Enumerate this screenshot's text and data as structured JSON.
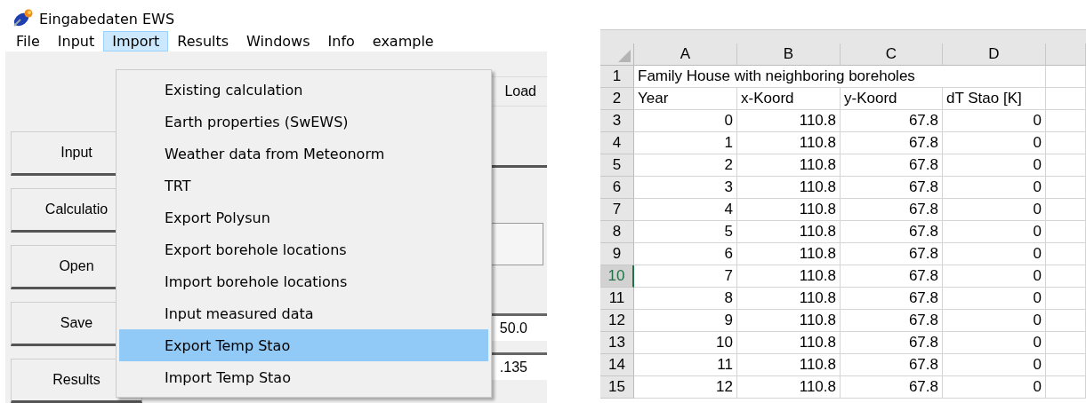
{
  "app": {
    "title": "Eingabedaten EWS",
    "menu": [
      {
        "label": "File",
        "selected": false
      },
      {
        "label": "Input",
        "selected": false
      },
      {
        "label": "Import",
        "selected": true
      },
      {
        "label": "Results",
        "selected": false
      },
      {
        "label": "Windows",
        "selected": false
      },
      {
        "label": "Info",
        "selected": false
      },
      {
        "label": "example",
        "selected": false
      }
    ],
    "side_buttons": [
      "Input",
      "Calculatio",
      "Open",
      "Save",
      "Results"
    ],
    "panel": {
      "load_label": "Load",
      "field_1": "50.0",
      "field_2": ".135"
    },
    "dropdown": [
      {
        "label": "Existing calculation",
        "selected": false
      },
      {
        "label": "Earth properties (SwEWS)",
        "selected": false
      },
      {
        "label": "Weather data from Meteonorm",
        "selected": false
      },
      {
        "label": "TRT",
        "selected": false
      },
      {
        "label": "Export Polysun",
        "selected": false
      },
      {
        "label": "Export borehole locations",
        "selected": false
      },
      {
        "label": "Import borehole locations",
        "selected": false
      },
      {
        "label": "Input measured data",
        "selected": false
      },
      {
        "label": "Export Temp Stao",
        "selected": true
      },
      {
        "label": "Import Temp Stao",
        "selected": false
      }
    ]
  },
  "sheet": {
    "columns": [
      "A",
      "B",
      "C",
      "D"
    ],
    "rows": [
      {
        "number": "1",
        "selected": false,
        "kind": "title",
        "cells": [
          "Family House with neighboring boreholes"
        ]
      },
      {
        "number": "2",
        "selected": false,
        "kind": "header",
        "cells": [
          "Year",
          "x-Koord",
          "y-Koord",
          "dT Stao [K]"
        ]
      },
      {
        "number": "3",
        "selected": false,
        "kind": "data",
        "cells": [
          "0",
          "110.8",
          "67.8",
          "0"
        ]
      },
      {
        "number": "4",
        "selected": false,
        "kind": "data",
        "cells": [
          "1",
          "110.8",
          "67.8",
          "0"
        ]
      },
      {
        "number": "5",
        "selected": false,
        "kind": "data",
        "cells": [
          "2",
          "110.8",
          "67.8",
          "0"
        ]
      },
      {
        "number": "6",
        "selected": false,
        "kind": "data",
        "cells": [
          "3",
          "110.8",
          "67.8",
          "0"
        ]
      },
      {
        "number": "7",
        "selected": false,
        "kind": "data",
        "cells": [
          "4",
          "110.8",
          "67.8",
          "0"
        ]
      },
      {
        "number": "8",
        "selected": false,
        "kind": "data",
        "cells": [
          "5",
          "110.8",
          "67.8",
          "0"
        ]
      },
      {
        "number": "9",
        "selected": false,
        "kind": "data",
        "cells": [
          "6",
          "110.8",
          "67.8",
          "0"
        ]
      },
      {
        "number": "10",
        "selected": true,
        "kind": "data",
        "cells": [
          "7",
          "110.8",
          "67.8",
          "0"
        ]
      },
      {
        "number": "11",
        "selected": false,
        "kind": "data",
        "cells": [
          "8",
          "110.8",
          "67.8",
          "0"
        ]
      },
      {
        "number": "12",
        "selected": false,
        "kind": "data",
        "cells": [
          "9",
          "110.8",
          "67.8",
          "0"
        ]
      },
      {
        "number": "13",
        "selected": false,
        "kind": "data",
        "cells": [
          "10",
          "110.8",
          "67.8",
          "0"
        ]
      },
      {
        "number": "14",
        "selected": false,
        "kind": "data",
        "cells": [
          "11",
          "110.8",
          "67.8",
          "0"
        ]
      },
      {
        "number": "15",
        "selected": false,
        "kind": "data",
        "cells": [
          "12",
          "110.8",
          "67.8",
          "0"
        ]
      }
    ]
  }
}
